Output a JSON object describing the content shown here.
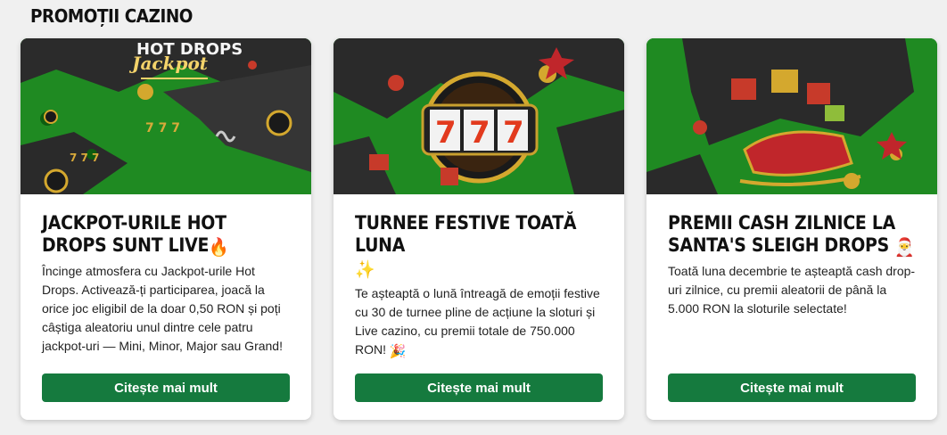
{
  "section": {
    "title": "PROMOȚII CAZINO"
  },
  "cards": [
    {
      "image_text": "Jackpot",
      "image_text_top": "HOT DROPS",
      "title": "JACKPOT-URILE HOT DROPS SUNT LIVE",
      "title_emoji": "🔥",
      "text": "Încinge atmosfera cu Jackpot-urile Hot Drops. Activează-ți participarea, joacă la orice joc eligibil de la doar 0,50 RON și poți câștiga aleatoriu unul dintre cele patru jackpot-uri — Mini, Minor, Major sau Grand!",
      "button_label": "Citește mai mult"
    },
    {
      "image_text": "777",
      "title": "TURNEE FESTIVE TOATĂ LUNA",
      "title_emoji": "✨",
      "text": "Te așteaptă o lună întreagă de emoții festive cu 30 de turnee pline de acțiune la sloturi și Live cazino, cu premii totale de 750.000 RON!",
      "text_emoji": "🎉",
      "button_label": "Citește mai mult"
    },
    {
      "title": "PREMII CASH ZILNICE LA SANTA'S SLEIGH DROPS",
      "title_emoji": "🎅",
      "text": "Toată luna decembrie te așteaptă cash drop-uri zilnice, cu premii aleatorii de până la 5.000 RON la sloturile selectate!",
      "button_label": "Citește mai mult"
    }
  ],
  "colors": {
    "page_background": "#f0f0f0",
    "button": "#157a3e",
    "banner_green": "#1c7a1c",
    "torn_dark": "#2a2a2a"
  }
}
